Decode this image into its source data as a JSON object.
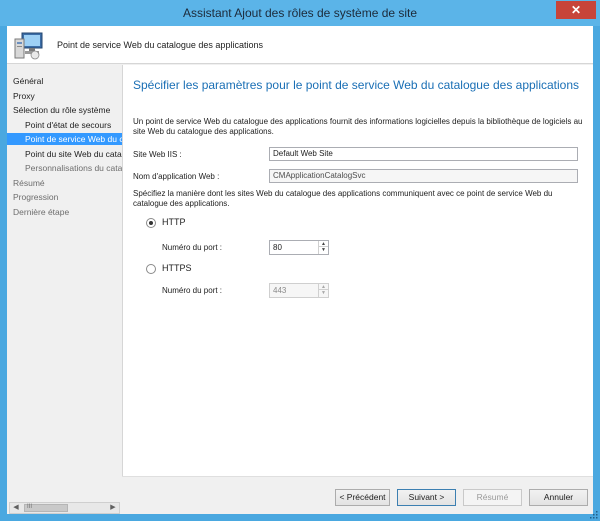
{
  "window": {
    "title": "Assistant Ajout des rôles de système de site",
    "close_label": "✕"
  },
  "header": {
    "title": "Point de service Web du catalogue des applications",
    "icon": "computer-icon"
  },
  "nav": {
    "items": [
      {
        "label": "Général",
        "level": 0,
        "state": "normal"
      },
      {
        "label": "Proxy",
        "level": 0,
        "state": "normal"
      },
      {
        "label": "Sélection du rôle système",
        "level": 0,
        "state": "normal"
      },
      {
        "label": "Point d'état de secours",
        "level": 1,
        "state": "normal"
      },
      {
        "label": "Point de service Web du catalogue des applications",
        "level": 1,
        "state": "active"
      },
      {
        "label": "Point du site Web du catalogue des applications",
        "level": 1,
        "state": "normal"
      },
      {
        "label": "Personnalisations du catalogue des applications",
        "level": 1,
        "state": "dim"
      },
      {
        "label": "Résumé",
        "level": 0,
        "state": "dim"
      },
      {
        "label": "Progression",
        "level": 0,
        "state": "dim"
      },
      {
        "label": "Dernière étape",
        "level": 0,
        "state": "dim"
      }
    ],
    "scroll_grip": "III"
  },
  "content": {
    "title": "Spécifier les paramètres pour le point de service Web du catalogue des applications",
    "description": "Un point de service Web du catalogue des applications fournit des informations logicielles depuis la bibliothèque de logiciels au site Web du catalogue des applications.",
    "iis_label": "Site Web IIS :",
    "iis_value": "Default Web Site",
    "app_name_label": "Nom d'application Web :",
    "app_name_value": "CMApplicationCatalogSvc",
    "comm_text": "Spécifiez la manière dont les sites Web du catalogue des applications communiquent avec ce point de service Web du catalogue des applications.",
    "http_label": "HTTP",
    "http_selected": true,
    "http_port_label": "Numéro du port :",
    "http_port": "80",
    "https_label": "HTTPS",
    "https_selected": false,
    "https_port_label": "Numéro du port :",
    "https_port": "443"
  },
  "footer": {
    "prev": "< Précédent",
    "next": "Suivant >",
    "summary": "Résumé",
    "cancel": "Annuler"
  },
  "colors": {
    "title_bar": "#5bb4e8",
    "accent_title": "#1a6fb5",
    "selection": "#3399ff",
    "close": "#c7443a"
  }
}
